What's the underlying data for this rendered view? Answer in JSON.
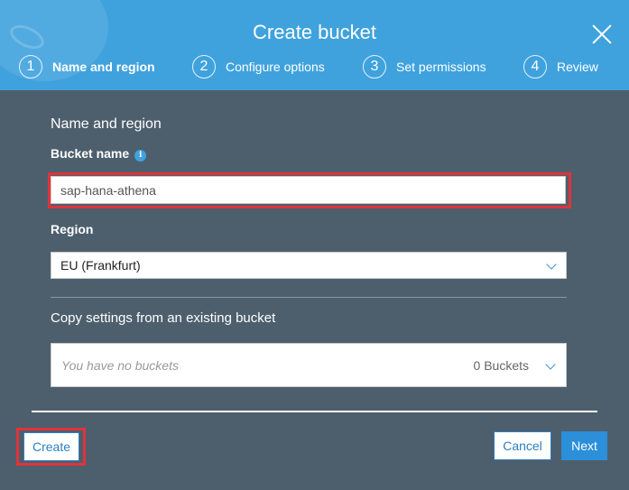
{
  "dialog": {
    "title": "Create bucket"
  },
  "steps": [
    {
      "number": "1",
      "label": "Name and region",
      "active": true
    },
    {
      "number": "2",
      "label": "Configure options",
      "active": false
    },
    {
      "number": "3",
      "label": "Set permissions",
      "active": false
    },
    {
      "number": "4",
      "label": "Review",
      "active": false
    }
  ],
  "form": {
    "section_title": "Name and region",
    "bucket_name_label": "Bucket name",
    "bucket_name_value": "sap-hana-athena",
    "info_icon_glyph": "i",
    "region_label": "Region",
    "region_value": "EU (Frankfurt)",
    "copy_title": "Copy settings from an existing bucket",
    "copy_placeholder": "You have no buckets",
    "copy_count": "0 Buckets"
  },
  "footer": {
    "create_label": "Create",
    "cancel_label": "Cancel",
    "next_label": "Next"
  },
  "colors": {
    "header": "#3fa2dd",
    "body": "#4d5f6d",
    "highlight": "#e0333b",
    "accent": "#2b8fd9"
  },
  "icons": {
    "close": "close-icon",
    "info": "info-icon",
    "chevron": "chevron-down-icon"
  }
}
